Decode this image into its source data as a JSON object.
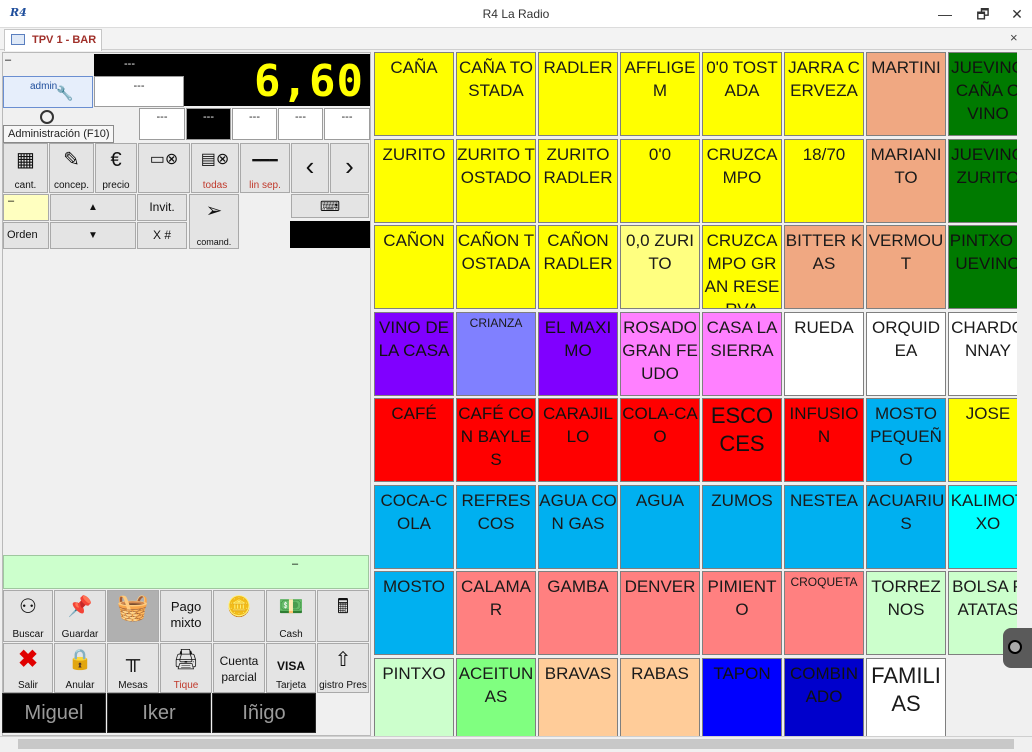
{
  "window": {
    "logo": "R4",
    "title": "R4 La Radio",
    "minimize": "—",
    "restore": "🗗",
    "close": "✕"
  },
  "tab": {
    "label": "TPV 1 - BAR",
    "close": "×"
  },
  "display": {
    "total": "6,60",
    "top_dash": "---",
    "white_dash": "---",
    "row_cells": [
      "---",
      "---",
      "---",
      "---",
      "---"
    ],
    "minus": "–"
  },
  "admin": {
    "label": "admin"
  },
  "tooltip": "Administración (F10)",
  "toolbar": {
    "cant": "cant.",
    "concep": "concep.",
    "precio": "precio",
    "todas": "todas",
    "lin_sep": "lin sep.",
    "invit": "Invit.",
    "orden": "Orden",
    "x_num": "X #",
    "comand": "comand.",
    "dash": "–"
  },
  "green_strip": {
    "text": "–"
  },
  "bottom_buttons": {
    "buscar": "Buscar",
    "guardar": "Guardar",
    "pago_mixto": "Pago mixto",
    "cash": "Cash",
    "salir": "Salir",
    "anular": "Anular",
    "mesas": "Mesas",
    "tique": "Tique",
    "cuenta_parcial": "Cuenta parcial",
    "tarjeta": "Tarjeta",
    "registro": "gistro Pres"
  },
  "waiters": [
    "Miguel",
    "Iker",
    "Iñigo"
  ],
  "colors": {
    "yellow": "#ffff00",
    "light_yellow": "#ffff80",
    "salmon": "#f0a882",
    "dark_green": "#007a00",
    "purple": "#8000ff",
    "lavender": "#8080ff",
    "pink": "#ff80ff",
    "white": "#ffffff",
    "red": "#ff0000",
    "sky": "#00b0f0",
    "cyan": "#00ffff",
    "light_red": "#ff8080",
    "light_green": "#ccffcc",
    "green": "#80ff80",
    "peach": "#ffcc99",
    "blue": "#0000ff",
    "navy": "#0000cc"
  },
  "products": [
    [
      {
        "t": "CAÑA",
        "c": "#ffff00"
      },
      {
        "t": "CAÑA TOSTADA",
        "c": "#ffff00"
      },
      {
        "t": "RADLER",
        "c": "#ffff00"
      },
      {
        "t": "AFFLIGEM",
        "c": "#ffff00",
        "s": "m"
      },
      {
        "t": "0'0 TOSTADA",
        "c": "#ffff00",
        "s": "m"
      },
      {
        "t": "JARRA CERVEZA",
        "c": "#ffff00",
        "s": "m"
      },
      {
        "t": "MARTINI",
        "c": "#f0a882",
        "s": "m"
      },
      {
        "t": "JUEVINO CAÑA O VINO",
        "c": "#007a00",
        "s": "m"
      }
    ],
    [
      {
        "t": "ZURITO",
        "c": "#ffff00"
      },
      {
        "t": "ZURITO TOSTADO",
        "c": "#ffff00"
      },
      {
        "t": "ZURITO RADLER",
        "c": "#ffff00"
      },
      {
        "t": "0'0",
        "c": "#ffff00",
        "s": "m"
      },
      {
        "t": "CRUZCAMPO",
        "c": "#ffff00",
        "s": "m"
      },
      {
        "t": "18/70",
        "c": "#ffff00",
        "s": "m"
      },
      {
        "t": "MARIANITO",
        "c": "#f0a882",
        "s": "m"
      },
      {
        "t": "JUEVINO ZURITO",
        "c": "#007a00",
        "s": "m"
      }
    ],
    [
      {
        "t": "CAÑON",
        "c": "#ffff00"
      },
      {
        "t": "CAÑON TOSTADA",
        "c": "#ffff00",
        "s": "m"
      },
      {
        "t": "CAÑON RADLER",
        "c": "#ffff00"
      },
      {
        "t": "0,0 ZURITO",
        "c": "#ffff80"
      },
      {
        "t": "CRUZCAMPO GRAN RESERVA",
        "c": "#ffff00",
        "s": "m"
      },
      {
        "t": "BITTER KAS",
        "c": "#f0a882",
        "s": "m"
      },
      {
        "t": "VERMOUT",
        "c": "#f0a882",
        "s": "m"
      },
      {
        "t": "PINTXO JUEVINO",
        "c": "#007a00",
        "s": "m"
      }
    ],
    [
      {
        "t": "VINO DE LA CASA",
        "c": "#8000ff",
        "s": "m"
      },
      {
        "t": "CRIANZA",
        "c": "#8080ff",
        "s": "s"
      },
      {
        "t": "EL MAXIMO",
        "c": "#8000ff",
        "s": "m"
      },
      {
        "t": "ROSADO GRAN FEUDO",
        "c": "#ff80ff",
        "s": "m"
      },
      {
        "t": "CASA LASIERRA",
        "c": "#ff80ff"
      },
      {
        "t": "RUEDA",
        "c": "#ffffff",
        "s": "m"
      },
      {
        "t": "ORQUIDEA",
        "c": "#ffffff",
        "s": "m"
      },
      {
        "t": "CHARDONNAY",
        "c": "#ffffff",
        "s": "m"
      }
    ],
    [
      {
        "t": "CAFÉ",
        "c": "#ff0000",
        "s": "m"
      },
      {
        "t": "CAFÉ CON BAYLES",
        "c": "#ff0000",
        "s": "m"
      },
      {
        "t": "CARAJILLO",
        "c": "#ff0000",
        "s": "m"
      },
      {
        "t": "COLA-CAO",
        "c": "#ff0000",
        "s": "m"
      },
      {
        "t": "ESCOCES",
        "c": "#ff0000",
        "s": "b"
      },
      {
        "t": "INFUSION",
        "c": "#ff0000",
        "s": "m"
      },
      {
        "t": "MOSTO PEQUEÑO",
        "c": "#00b0f0",
        "s": "m"
      },
      {
        "t": "JOSE",
        "c": "#ffff00"
      }
    ],
    [
      {
        "t": "COCA-COLA",
        "c": "#00b0f0",
        "s": "m"
      },
      {
        "t": "REFRESCOS",
        "c": "#00b0f0",
        "s": "m"
      },
      {
        "t": "AGUA CON GAS",
        "c": "#00b0f0",
        "s": "m"
      },
      {
        "t": "AGUA",
        "c": "#00b0f0",
        "s": "m"
      },
      {
        "t": "ZUMOS",
        "c": "#00b0f0",
        "s": "m"
      },
      {
        "t": "NESTEA",
        "c": "#00b0f0",
        "s": "m"
      },
      {
        "t": "ACUARIUS",
        "c": "#00b0f0",
        "s": "m"
      },
      {
        "t": "KALIMOTXO",
        "c": "#00ffff"
      }
    ],
    [
      {
        "t": "MOSTO",
        "c": "#00b0f0",
        "s": "m"
      },
      {
        "t": "CALAMAR",
        "c": "#ff8080",
        "s": "m"
      },
      {
        "t": "GAMBA",
        "c": "#ff8080",
        "s": "m"
      },
      {
        "t": "DENVER",
        "c": "#ff8080"
      },
      {
        "t": "PIMIENTO",
        "c": "#ff8080",
        "s": "m"
      },
      {
        "t": "CROQUETA",
        "c": "#ff8080",
        "s": "s"
      },
      {
        "t": "TORREZNOS",
        "c": "#ccffcc",
        "s": "m"
      },
      {
        "t": "BOLSA PATATAS",
        "c": "#ccffcc",
        "s": "m"
      }
    ],
    [
      {
        "t": "PINTXO",
        "c": "#ccffcc",
        "s": "m"
      },
      {
        "t": "ACEITUNAS",
        "c": "#80ff80",
        "s": "m"
      },
      {
        "t": "BRAVAS",
        "c": "#ffcc99",
        "s": "m"
      },
      {
        "t": "RABAS",
        "c": "#ffcc99",
        "s": "m"
      },
      {
        "t": "TAPON",
        "c": "#0000ff",
        "s": "m"
      },
      {
        "t": "COMBINADO",
        "c": "#0000cc",
        "s": "m"
      },
      {
        "t": "FAMILIAS",
        "c": "#ffffff",
        "s": "b"
      },
      {
        "t": "",
        "c": "#f0f0f0"
      }
    ]
  ]
}
